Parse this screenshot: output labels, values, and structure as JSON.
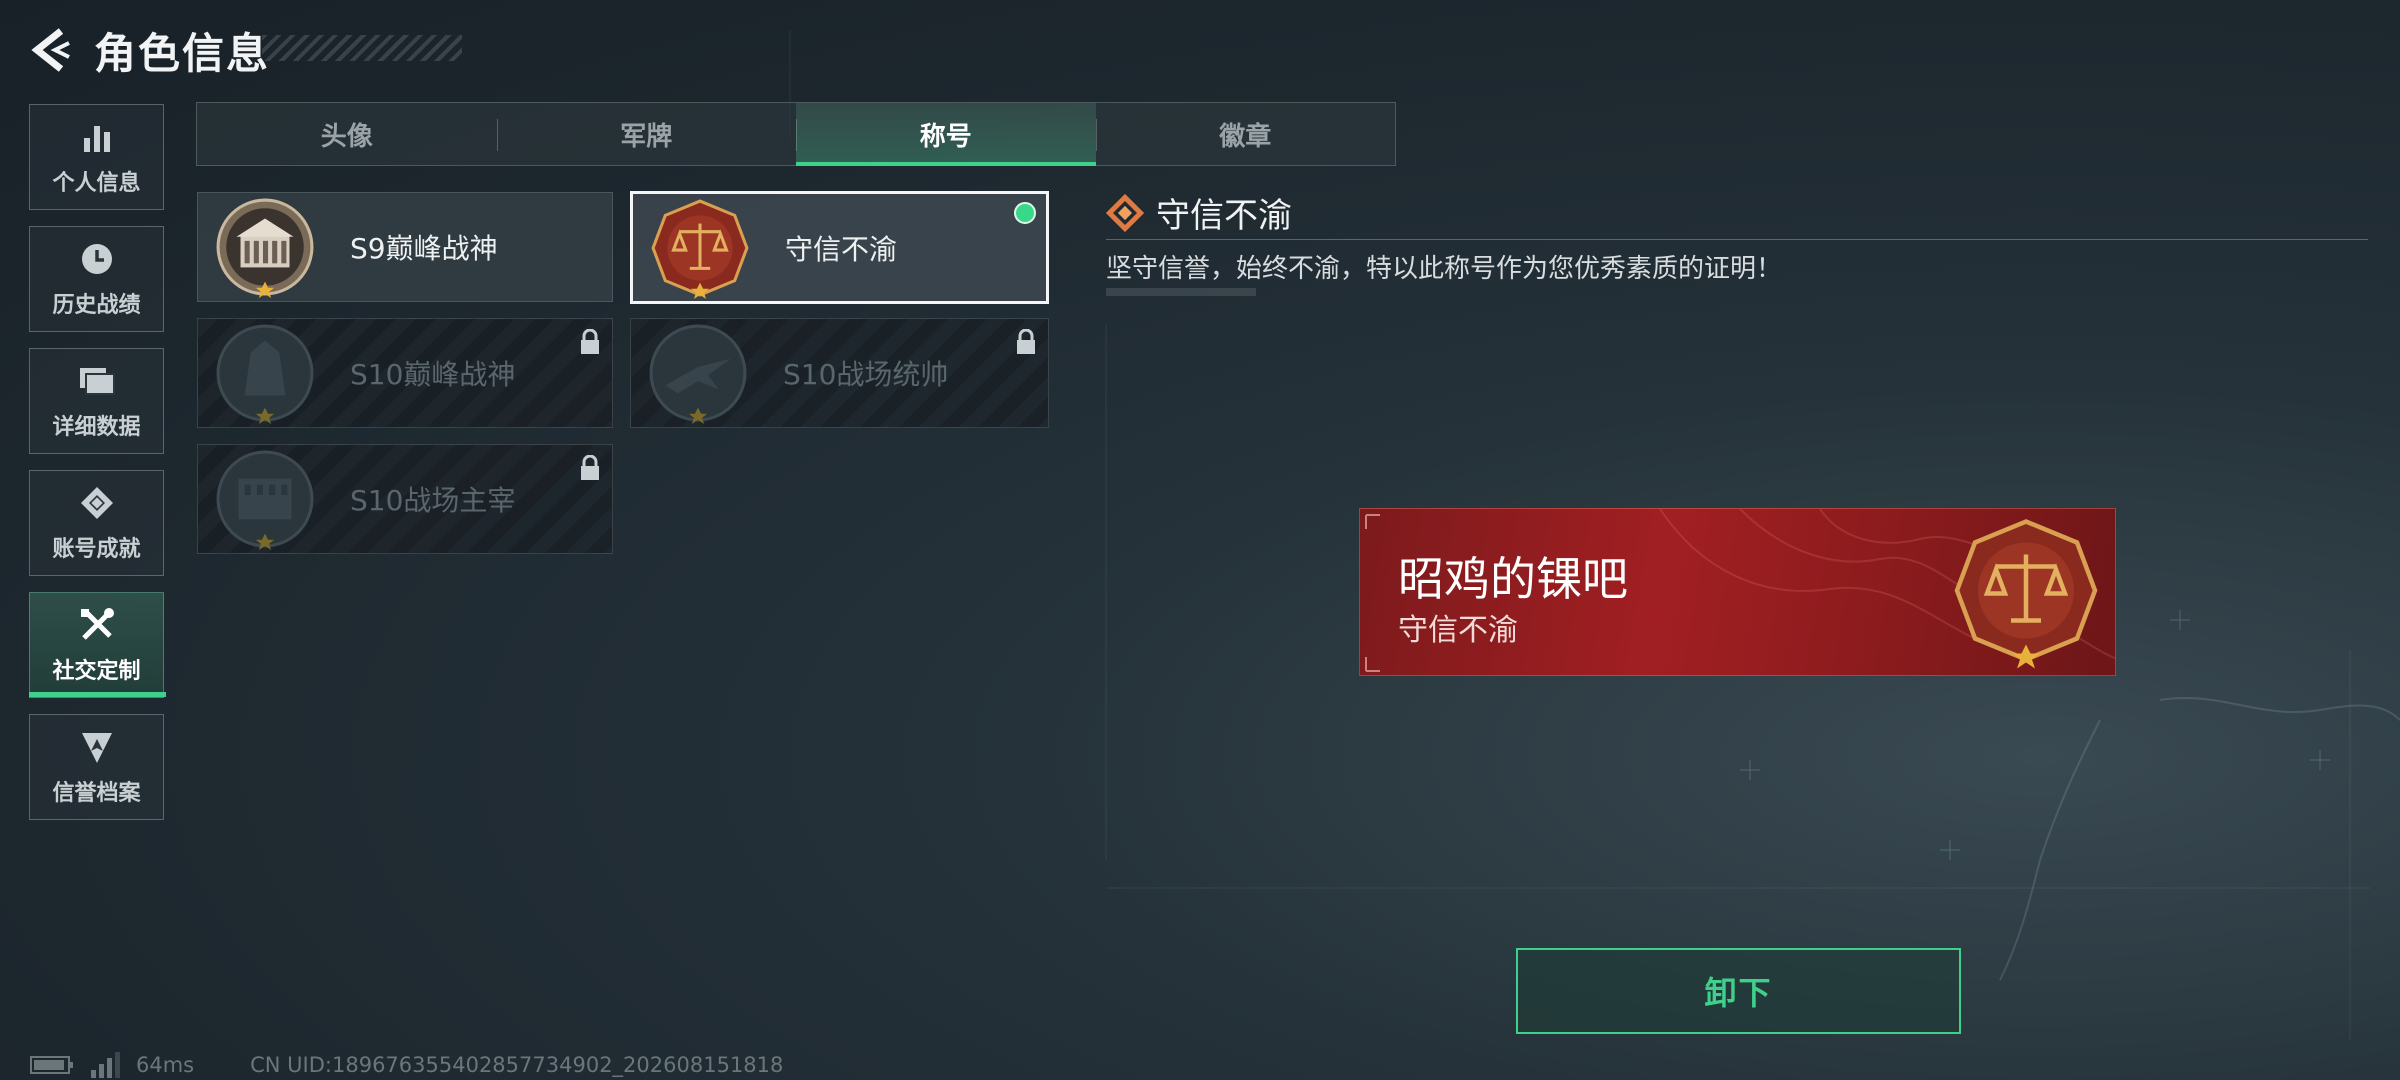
{
  "header": {
    "title": "角色信息"
  },
  "sidebar": {
    "items": [
      {
        "label": "个人信息",
        "icon": "bar-chart-icon"
      },
      {
        "label": "历史战绩",
        "icon": "clock-icon"
      },
      {
        "label": "详细数据",
        "icon": "folder-icon"
      },
      {
        "label": "账号成就",
        "icon": "achievement-icon"
      },
      {
        "label": "社交定制",
        "icon": "tools-icon",
        "active": true
      },
      {
        "label": "信誉档案",
        "icon": "shield-arrow-icon"
      }
    ]
  },
  "tabs": [
    {
      "label": "头像"
    },
    {
      "label": "军牌"
    },
    {
      "label": "称号",
      "active": true
    },
    {
      "label": "徽章"
    }
  ],
  "cards": [
    {
      "name": "S9巅峰战神",
      "locked": false,
      "selected": false
    },
    {
      "name": "守信不渝",
      "locked": false,
      "selected": true,
      "equipped": true
    },
    {
      "name": "S10巅峰战神",
      "locked": true
    },
    {
      "name": "S10战场统帅",
      "locked": true
    },
    {
      "name": "S10战场主宰",
      "locked": true
    }
  ],
  "detail": {
    "title": "守信不渝",
    "description": "坚守信誉，始终不渝，特以此称号作为您优秀素质的证明！"
  },
  "preview": {
    "player_name": "昭鸡的锞吧",
    "title": "守信不渝"
  },
  "unequip_button": {
    "label": "卸下"
  },
  "status": {
    "ping": "64ms",
    "uid": "CN UID:18967635540285773490​2_202608151818"
  },
  "colors": {
    "accent": "#3fd08c",
    "banner_red": "#a11f22"
  }
}
